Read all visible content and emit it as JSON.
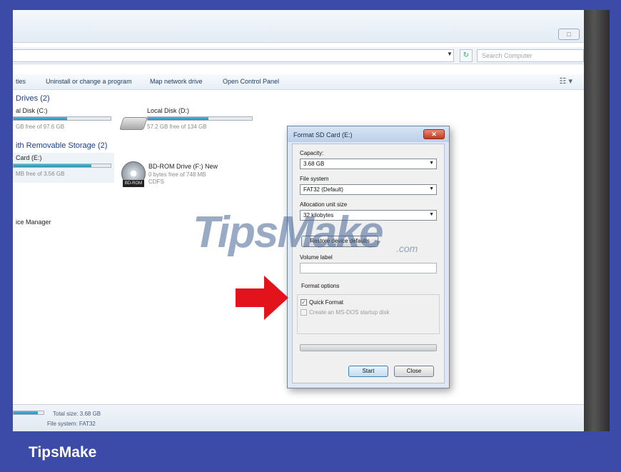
{
  "explorer": {
    "search_placeholder": "Search Computer",
    "toolbar": {
      "uninstall": "Uninstall or change a program",
      "map_drive": "Map network drive",
      "control_panel": "Open Control Panel",
      "partial_left": "ties"
    },
    "hard_drives": {
      "heading": "Drives (2)",
      "drive_c": {
        "name": "al Disk (C:)",
        "free": "GB free of 97.6 GB",
        "used_fraction": 0.55
      },
      "drive_d": {
        "name": "Local Disk (D:)",
        "free": "57.2 GB free of 134 GB",
        "used_fraction": 0.58
      }
    },
    "removable": {
      "heading": "ith Removable Storage (2)",
      "sd_card": {
        "name": "Card (E:)",
        "free": "MB free of 3.56 GB",
        "used_fraction": 0.8
      },
      "bd_rom": {
        "name": "BD-ROM Drive (F:) New",
        "free": "0 bytes free of 748 MB",
        "fs": "CDFS",
        "tag": "BD-ROM"
      }
    },
    "other": {
      "device_manager": "ice Manager"
    },
    "status": {
      "total_size": "Total size: 3.68 GB",
      "file_system": "File system: FAT32"
    },
    "window_button": "□"
  },
  "dialog": {
    "title": "Format SD Card (E:)",
    "close_symbol": "✕",
    "capacity_label": "Capacity:",
    "capacity_value": "3.68 GB",
    "fs_label": "File system",
    "fs_value": "FAT32 (Default)",
    "alloc_label": "Allocation unit size",
    "alloc_value": "32 kilobytes",
    "restore_button": "Restore device defaults",
    "volume_label": "Volume label",
    "volume_value": "",
    "options_label": "Format options",
    "quick_format": "Quick Format",
    "quick_format_checked": "✓",
    "msdos_disk": "Create an MS-DOS startup disk",
    "progress": 0,
    "start_button": "Start",
    "close_button": "Close"
  },
  "watermark": {
    "text": "TipsMake",
    "suffix": ".com"
  },
  "brand": "TipsMake",
  "colors": {
    "background": "#3c4aa8",
    "arrow": "#e3131b",
    "drive_bar": "#2a8fb6"
  }
}
